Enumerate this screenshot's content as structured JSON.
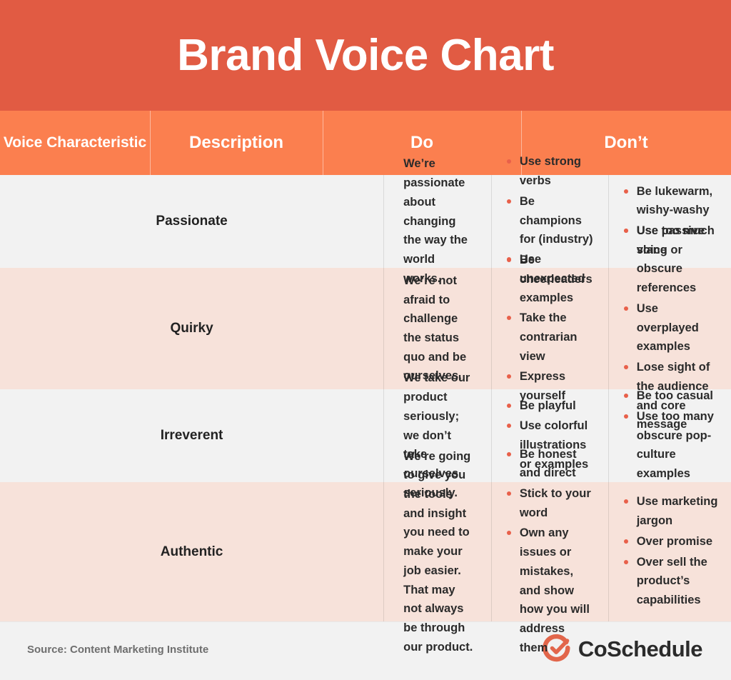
{
  "banner": {
    "title": "Brand Voice Chart",
    "bg_color": "#E15B43"
  },
  "palette": {
    "banner": "#E15B43",
    "header_strip": "#FB7F4F",
    "row_light": "#F2F2F2",
    "row_pink": "#F7E2DA",
    "bullet": "#E8604A",
    "text": "#2B2B2B"
  },
  "table": {
    "columns": [
      {
        "label": "Voice Characteristic",
        "key": "name"
      },
      {
        "label": "Description",
        "key": "description"
      },
      {
        "label": "Do",
        "key": "do"
      },
      {
        "label": "Don’t",
        "key": "dont"
      }
    ],
    "rows": [
      {
        "name": "Passionate",
        "description": "We’re passionate about changing the way the world works.",
        "do": [
          "Use strong verbs",
          "Be champions for (industry)",
          "Be cheerleaders"
        ],
        "dont": [
          "Be lukewarm, wishy-washy",
          "Use passive voice"
        ]
      },
      {
        "name": "Quirky",
        "description": "We’re not afraid to challenge the status quo and be ourselves.",
        "do": [
          "Use unexpected examples",
          "Take the contrarian view",
          "Express yourself"
        ],
        "dont": [
          "Use too much slang or obscure references",
          "Use overplayed examples",
          "Lose sight of the audience and core message"
        ]
      },
      {
        "name": "Irreverent",
        "description": "We take our product seriously; we don’t take ourselves seriously.",
        "do": [
          "Be playful",
          "Use colorful illustrations or examples"
        ],
        "dont": [
          "Be too casual",
          "Use too many obscure pop-culture examples"
        ]
      },
      {
        "name": "Authentic",
        "description": "We’re going to give you the tools and insight you need to make your job easier. That may not always be through our product.",
        "do": [
          "Be honest and direct",
          "Stick to your word",
          "Own any issues or mistakes, and show how you will address them"
        ],
        "dont": [
          "Use marketing jargon",
          "Over promise",
          "Over sell the product’s capabilities"
        ]
      }
    ]
  },
  "footer": {
    "source": "Source: Content Marketing Institute",
    "logo_text": "CoSchedule",
    "logo_icon": "coschedule-check-circle-icon",
    "logo_color": "#E2664B"
  }
}
